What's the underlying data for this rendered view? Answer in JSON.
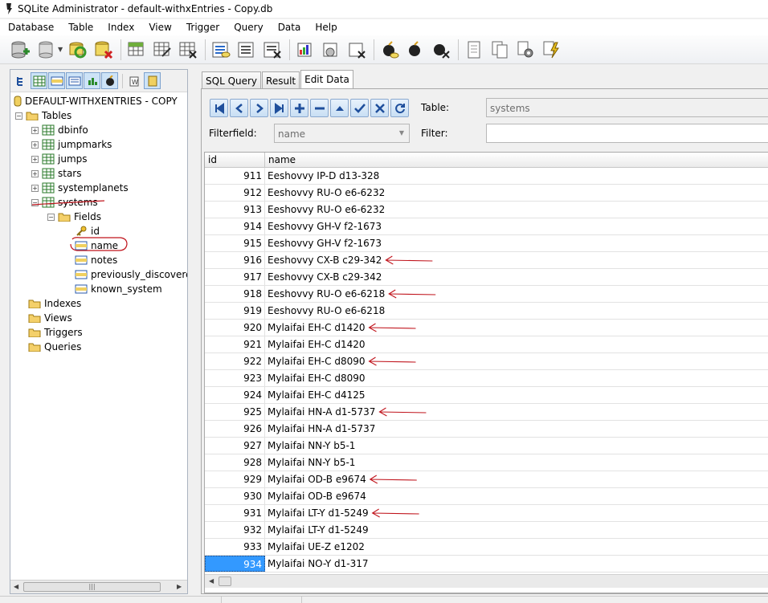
{
  "window": {
    "title": "SQLite Administrator - default-withxEntries - Copy.db"
  },
  "menu": [
    "Database",
    "Table",
    "Index",
    "View",
    "Trigger",
    "Query",
    "Data",
    "Help"
  ],
  "tree": {
    "root": "DEFAULT-WITHXENTRIES - COPY",
    "tables_label": "Tables",
    "tables": [
      "dbinfo",
      "jumpmarks",
      "jumps",
      "stars",
      "systemplanets",
      "systems"
    ],
    "fields_label": "Fields",
    "fields": [
      "id",
      "name",
      "notes",
      "previously_discovered",
      "known_system"
    ],
    "other": [
      "Indexes",
      "Views",
      "Triggers",
      "Queries"
    ],
    "scroll_grip": "|||"
  },
  "tabs": [
    "SQL Query",
    "Result",
    "Edit Data"
  ],
  "edit": {
    "table_label": "Table:",
    "table_value": "systems",
    "filterfield_label": "Filterfield:",
    "filterfield_value": "name",
    "filter_label": "Filter:",
    "filter_value": ""
  },
  "nav_icons": [
    "first-record-icon",
    "previous-record-icon",
    "next-record-icon",
    "last-record-icon",
    "insert-record-icon",
    "delete-record-icon",
    "edit-record-icon",
    "post-edit-icon",
    "cancel-edit-icon",
    "refresh-icon"
  ],
  "grid": {
    "columns": [
      "id",
      "name"
    ],
    "rows": [
      {
        "id": "911",
        "name": "Eeshovvy IP-D d13-328"
      },
      {
        "id": "912",
        "name": "Eeshovvy RU-O e6-6232"
      },
      {
        "id": "913",
        "name": "Eeshovvy RU-O e6-6232"
      },
      {
        "id": "914",
        "name": "Eeshovvy GH-V f2-1673"
      },
      {
        "id": "915",
        "name": "Eeshovvy GH-V f2-1673"
      },
      {
        "id": "916",
        "name": "Eeshovvy CX-B c29-342"
      },
      {
        "id": "917",
        "name": "Eeshovvy CX-B c29-342"
      },
      {
        "id": "918",
        "name": "Eeshovvy RU-O e6-6218"
      },
      {
        "id": "919",
        "name": "Eeshovvy RU-O e6-6218"
      },
      {
        "id": "920",
        "name": "Mylaifai EH-C d1420"
      },
      {
        "id": "921",
        "name": "Mylaifai EH-C d1420"
      },
      {
        "id": "922",
        "name": "Mylaifai EH-C d8090"
      },
      {
        "id": "923",
        "name": "Mylaifai EH-C d8090"
      },
      {
        "id": "924",
        "name": "Mylaifai EH-C d4125"
      },
      {
        "id": "925",
        "name": "Mylaifai HN-A d1-5737"
      },
      {
        "id": "926",
        "name": "Mylaifai HN-A d1-5737"
      },
      {
        "id": "927",
        "name": "Mylaifai NN-Y b5-1"
      },
      {
        "id": "928",
        "name": "Mylaifai NN-Y b5-1"
      },
      {
        "id": "929",
        "name": "Mylaifai OD-B e9674"
      },
      {
        "id": "930",
        "name": "Mylaifai OD-B e9674"
      },
      {
        "id": "931",
        "name": "Mylaifai LT-Y d1-5249"
      },
      {
        "id": "932",
        "name": "Mylaifai LT-Y d1-5249"
      },
      {
        "id": "933",
        "name": "Mylaifai UE-Z e1202"
      },
      {
        "id": "934",
        "name": "Mylaifai NO-Y d1-317"
      }
    ],
    "selected_id": "934",
    "annotated_ids": [
      "916",
      "918",
      "920",
      "922",
      "925",
      "929",
      "931"
    ]
  },
  "colors": {
    "selection": "#3399ff",
    "annotation": "#c0141c",
    "nav_blue": "#1f4f9c"
  }
}
